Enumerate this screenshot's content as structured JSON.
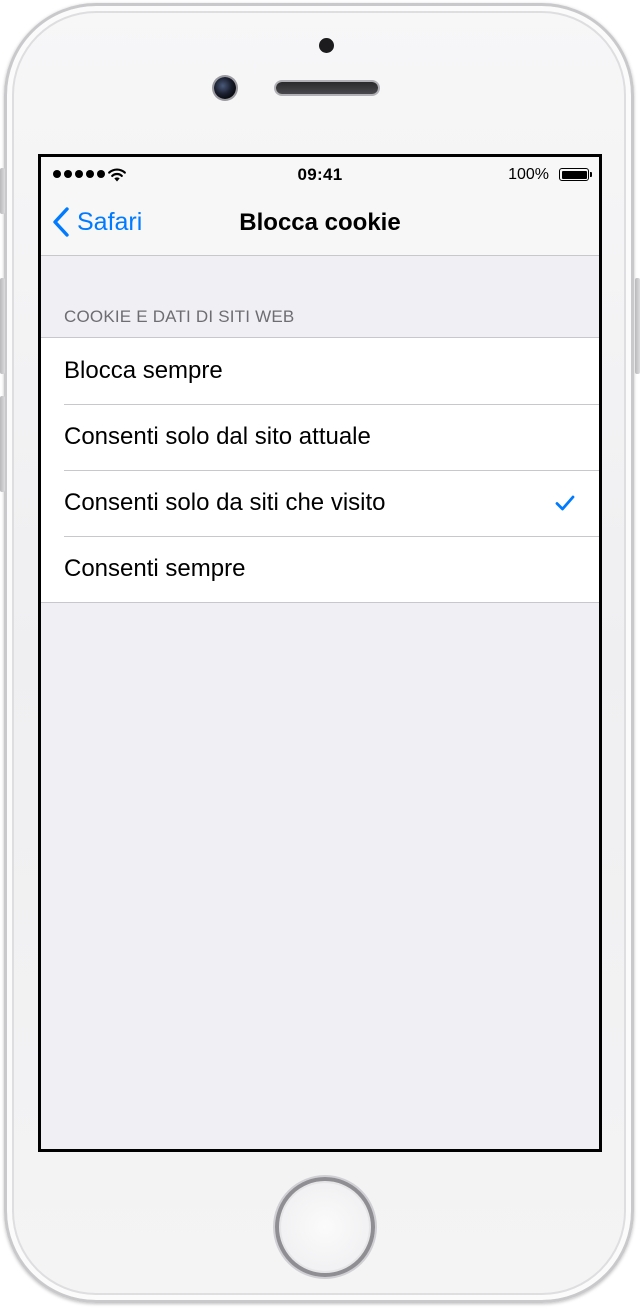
{
  "status_bar": {
    "time": "09:41",
    "battery_percent": "100%",
    "signal_dots": 5,
    "battery_level": 1.0
  },
  "nav": {
    "back_label": "Safari",
    "title": "Blocca cookie"
  },
  "section": {
    "header": "COOKIE E DATI DI SITI WEB"
  },
  "options": [
    {
      "label": "Blocca sempre",
      "selected": false
    },
    {
      "label": "Consenti solo dal sito attuale",
      "selected": false
    },
    {
      "label": "Consenti solo da siti che visito",
      "selected": true
    },
    {
      "label": "Consenti sempre",
      "selected": false
    }
  ],
  "colors": {
    "accent": "#007aff",
    "background": "#efeff4",
    "separator": "#c8c7cc",
    "header_text": "#6d6d72"
  },
  "icons": {
    "back": "chevron-left-icon",
    "selected": "checkmark-icon",
    "wifi": "wifi-icon",
    "battery": "battery-icon",
    "signal": "signal-dots-icon"
  }
}
